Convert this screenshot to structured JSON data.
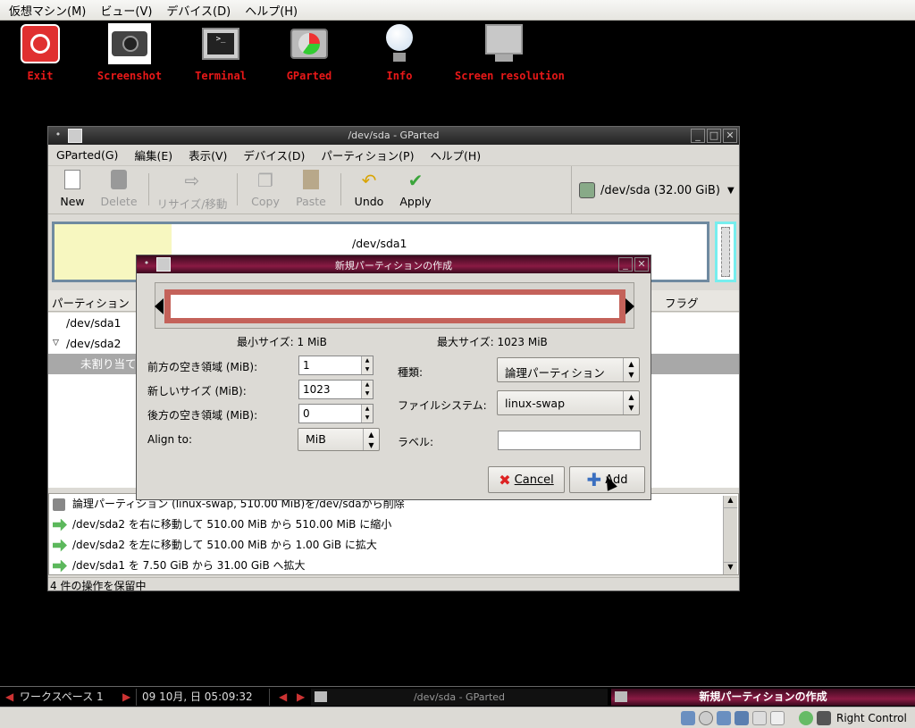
{
  "vbox_menu": [
    "仮想マシン(M)",
    "ビュー(V)",
    "デバイス(D)",
    "ヘルプ(H)"
  ],
  "desktop_icons": [
    {
      "label": "Exit",
      "icon": "power-icon"
    },
    {
      "label": "Screenshot",
      "icon": "camera-icon"
    },
    {
      "label": "Terminal",
      "icon": "terminal-icon"
    },
    {
      "label": "GParted",
      "icon": "gparted-icon"
    },
    {
      "label": "Info",
      "icon": "lightbulb-icon"
    },
    {
      "label": "Screen resolution",
      "icon": "monitor-icon"
    }
  ],
  "gparted": {
    "title": "/dev/sda - GParted",
    "menu": [
      "GParted(G)",
      "編集(E)",
      "表示(V)",
      "デバイス(D)",
      "パーティション(P)",
      "ヘルプ(H)"
    ],
    "toolbar": {
      "new": "New",
      "delete": "Delete",
      "resize": "リサイズ/移動",
      "copy": "Copy",
      "paste": "Paste",
      "undo": "Undo",
      "apply": "Apply"
    },
    "device": "/dev/sda  (32.00 GiB)",
    "visual_label": "/dev/sda1",
    "columns": {
      "partition": "パーティション",
      "flags": "フラグ"
    },
    "partitions": [
      "/dev/sda1",
      "/dev/sda2",
      "未割り当て"
    ],
    "ops": [
      "論理パーティション (linux-swap, 510.00 MiB)を/dev/sdaから削除",
      "/dev/sda2 を右に移動して 510.00 MiB から 510.00 MiB に縮小",
      "/dev/sda2 を左に移動して 510.00 MiB から 1.00 GiB に拡大",
      "/dev/sda1 を 7.50 GiB から 31.00 GiB へ拡大"
    ],
    "status": "4 件の操作を保留中"
  },
  "dialog": {
    "title": "新規パーティションの作成",
    "min_size": "最小サイズ:  1  MiB",
    "max_size": "最大サイズ:  1023  MiB",
    "free_before_label": "前方の空き領域 (MiB):",
    "free_before_value": "1",
    "new_size_label": "新しいサイズ (MiB):",
    "new_size_value": "1023",
    "free_after_label": "後方の空き領域 (MiB):",
    "free_after_value": "0",
    "align_label": "Align to:",
    "align_value": "MiB",
    "type_label": "種類:",
    "type_value": "論理パーティション",
    "fs_label": "ファイルシステム:",
    "fs_value": "linux-swap",
    "label_label": "ラベル:",
    "label_value": "",
    "cancel": "Cancel",
    "add": "Add"
  },
  "taskbar": {
    "workspace": "ワークスペース 1",
    "clock": "09 10月, 日 05:09:32",
    "task1": "/dev/sda - GParted",
    "task2": "新規パーティションの作成"
  },
  "vbox_status": {
    "host_key": "Right Control"
  }
}
